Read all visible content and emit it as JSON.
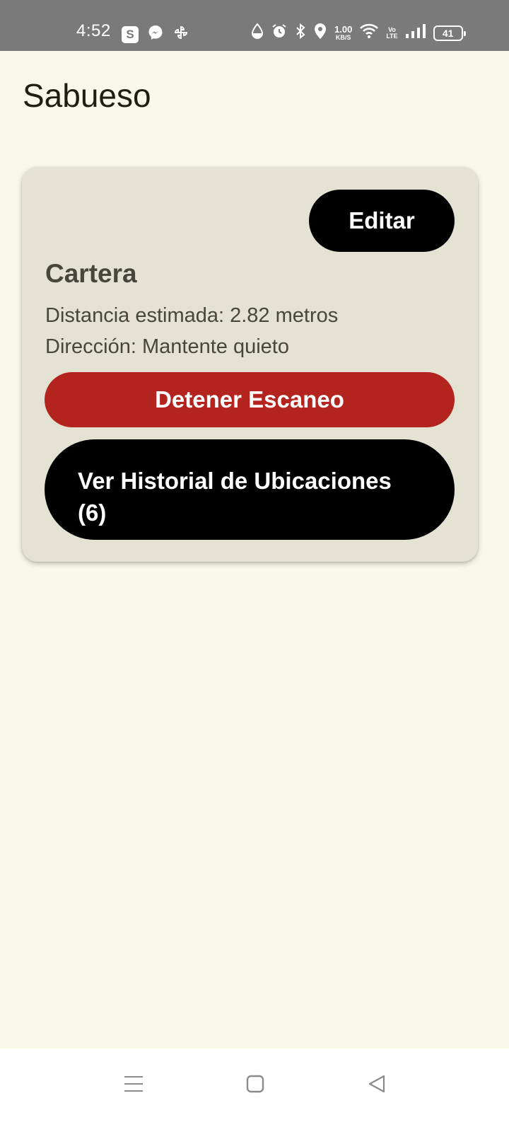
{
  "status_bar": {
    "time": "4:52",
    "s_badge": "S",
    "net_speed_value": "1.00",
    "net_speed_unit": "KB/S",
    "volte_top": "Vo",
    "volte_bottom": "LTE",
    "battery": "41",
    "icons": [
      "s-app-icon",
      "messenger-icon",
      "pinwheel-icon",
      "water-drop-icon",
      "alarm-icon",
      "bluetooth-icon",
      "location-icon",
      "wifi-icon",
      "signal-icon",
      "battery-icon"
    ]
  },
  "app": {
    "title": "Sabueso"
  },
  "card": {
    "edit_label": "Editar",
    "item_name": "Cartera",
    "distance_text": "Distancia estimada: 2.82 metros",
    "direction_text": "Dirección: Mantente quieto",
    "stop_label": "Detener Escaneo",
    "history_label": "Ver Historial de Ubicaciones (6)"
  },
  "nav_bar": {
    "icons": [
      "menu-icon",
      "home-icon",
      "back-icon"
    ]
  },
  "colors": {
    "background": "#f8f9e9",
    "card": "#e4e3d3",
    "status_bar": "#7a7a7a",
    "primary_button": "#000000",
    "stop_button": "#b3241e",
    "title_text": "#1e1e12",
    "body_text": "#47463a"
  }
}
